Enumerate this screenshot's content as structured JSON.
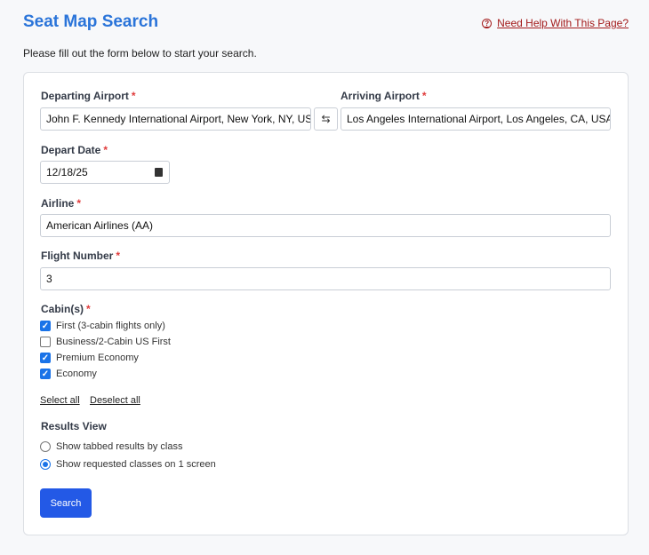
{
  "header": {
    "title": "Seat Map Search",
    "help_link": "Need Help With This Page?",
    "help_icon": "question-circle-icon",
    "intro": "Please fill out the form below to start your search."
  },
  "form": {
    "departing": {
      "label": "Departing Airport",
      "required": "*",
      "value": "John F. Kennedy International Airport, New York, NY, US"
    },
    "swap_icon": "swap-arrows-icon",
    "swap_glyph": "⇆",
    "arriving": {
      "label": "Arriving Airport",
      "required": "*",
      "value": "Los Angeles International Airport, Los Angeles, CA, USA"
    },
    "date": {
      "label": "Depart Date",
      "required": "*",
      "value": "12/18/25"
    },
    "airline": {
      "label": "Airline",
      "required": "*",
      "value": "American Airlines (AA)"
    },
    "flight": {
      "label": "Flight Number",
      "required": "*",
      "value": "3"
    },
    "cabins": {
      "label": "Cabin(s)",
      "required": "*",
      "options": [
        {
          "label": "First (3-cabin flights only)",
          "checked": true
        },
        {
          "label": "Business/2-Cabin US First",
          "checked": false
        },
        {
          "label": "Premium Economy",
          "checked": true
        },
        {
          "label": "Economy",
          "checked": true
        }
      ],
      "select_all": "Select all",
      "deselect_all": "Deselect all"
    },
    "results_view": {
      "label": "Results View",
      "options": [
        {
          "label": "Show tabbed results by class",
          "selected": false
        },
        {
          "label": "Show requested classes on 1 screen",
          "selected": true
        }
      ]
    },
    "submit": "Search"
  },
  "colors": {
    "accent": "#2a74d9",
    "button": "#2359e6",
    "help": "#a31b1b",
    "required": "#e03b3b"
  }
}
